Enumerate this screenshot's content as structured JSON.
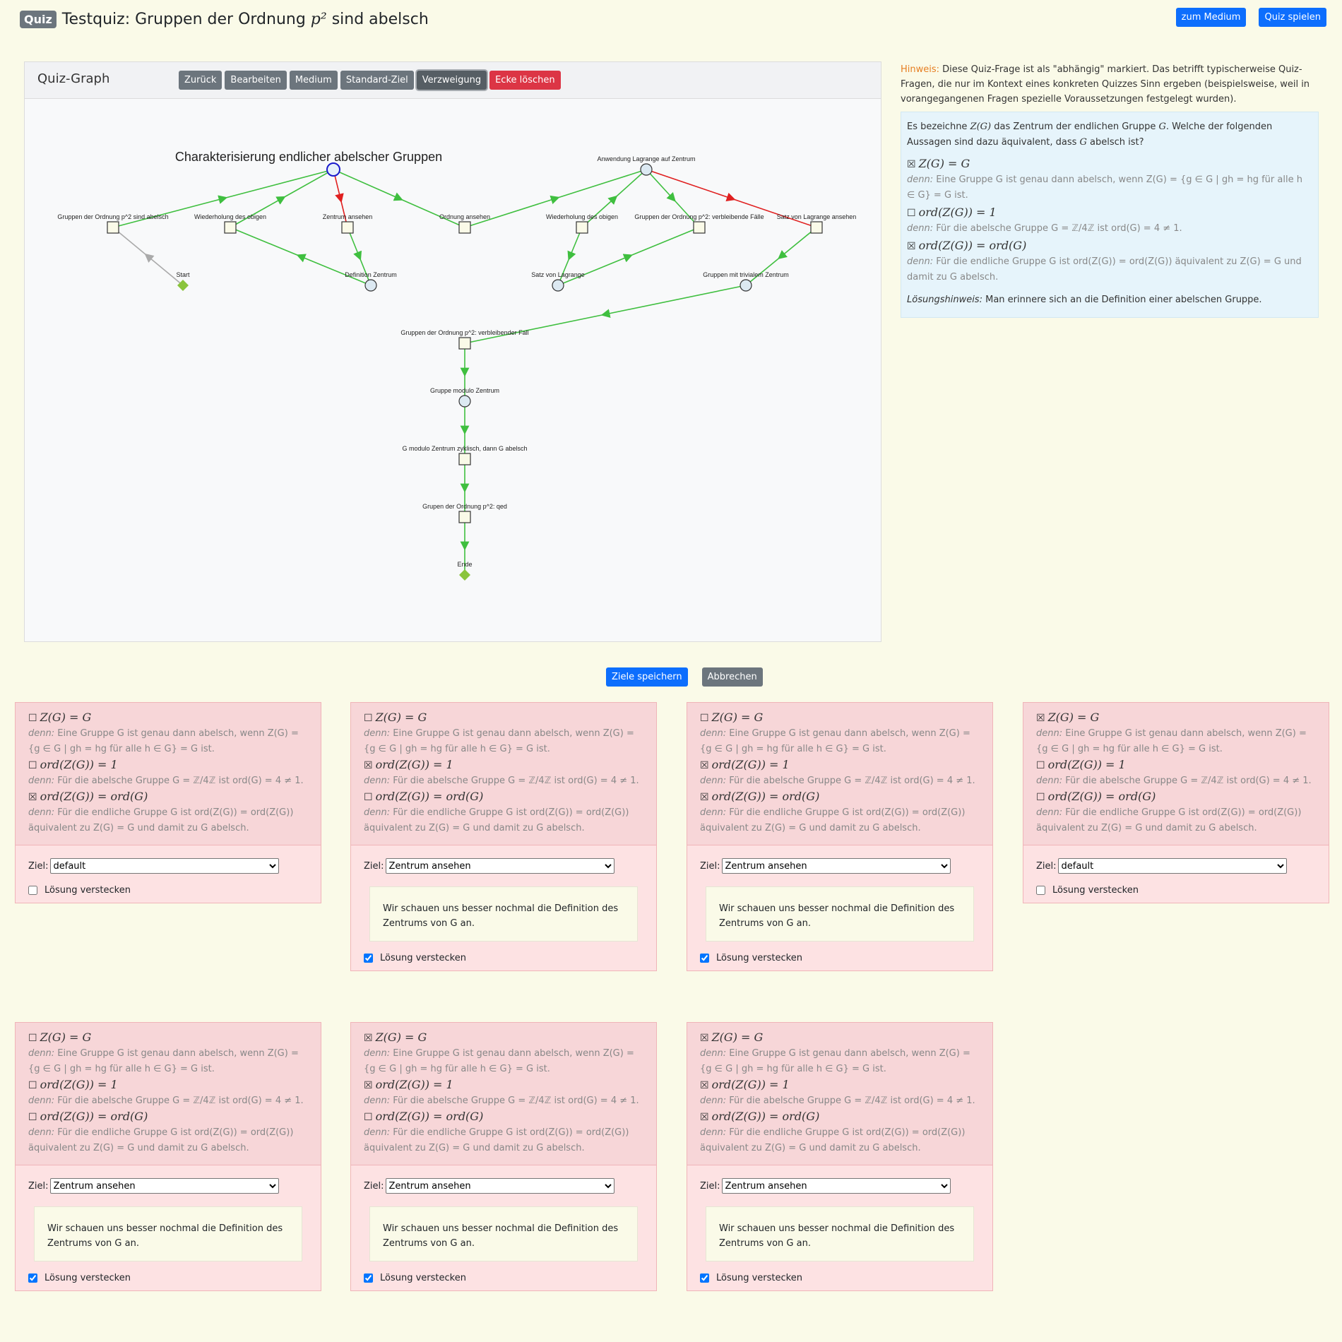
{
  "header": {
    "badge": "Quiz",
    "title_prefix": "Testquiz: Gruppen der Ordnung ",
    "title_math": "p²",
    "title_suffix": " sind abelsch",
    "btn_medium": "zum Medium",
    "btn_play": "Quiz spielen"
  },
  "graph": {
    "title": "Quiz-Graph",
    "toolbar": [
      "Zurück",
      "Bearbeiten",
      "Medium",
      "Standard-Ziel",
      "Verzweigung",
      "Ecke löschen"
    ],
    "heading": "Charakterisierung endlicher abelscher Gruppen",
    "nodes": [
      {
        "id": "root",
        "label": "",
        "shape": "circle-blue"
      },
      {
        "id": "lag",
        "label": "Anwendung Lagrange auf Zentrum",
        "shape": "circle"
      },
      {
        "id": "g1",
        "label": "Gruppen der Ordnung p^2 sind abelsch",
        "shape": "square"
      },
      {
        "id": "wh1",
        "label": "Wiederholung des obigen",
        "shape": "square"
      },
      {
        "id": "za",
        "label": "Zentrum ansehen",
        "shape": "square"
      },
      {
        "id": "oa",
        "label": "Ordnung ansehen",
        "shape": "square"
      },
      {
        "id": "wh2",
        "label": "Wiederholung des obigen",
        "shape": "square"
      },
      {
        "id": "grf",
        "label": "Gruppen der Ordnung p^2: verbleibende Fälle",
        "shape": "square"
      },
      {
        "id": "sla",
        "label": "Satz von Lagrange ansehen",
        "shape": "square"
      },
      {
        "id": "start",
        "label": "Start",
        "shape": "diamond"
      },
      {
        "id": "dz",
        "label": "Definition Zentrum",
        "shape": "circle"
      },
      {
        "id": "sl",
        "label": "Satz von Lagrange",
        "shape": "circle"
      },
      {
        "id": "gmt",
        "label": "Gruppen mit trivialem Zentrum",
        "shape": "circle"
      },
      {
        "id": "gvf",
        "label": "Gruppen der Ordnung p^2: verbleibender Fall",
        "shape": "square"
      },
      {
        "id": "gmz",
        "label": "Gruppe modulo Zentrum",
        "shape": "circle"
      },
      {
        "id": "gmzz",
        "label": "G modulo Zentrum zyklisch, dann G abelsch",
        "shape": "square"
      },
      {
        "id": "qed",
        "label": "Grupen der Ordnung p^2: qed",
        "shape": "square"
      },
      {
        "id": "ende",
        "label": "Ende",
        "shape": "diamond"
      }
    ],
    "edges": [
      {
        "from": "start",
        "to": "g1",
        "color": "gray"
      },
      {
        "from": "g1",
        "to": "root",
        "color": "green"
      },
      {
        "from": "wh1",
        "to": "root",
        "color": "green"
      },
      {
        "from": "root",
        "to": "za",
        "color": "red"
      },
      {
        "from": "root",
        "to": "oa",
        "color": "green"
      },
      {
        "from": "za",
        "to": "dz",
        "color": "green"
      },
      {
        "from": "dz",
        "to": "wh1",
        "color": "green"
      },
      {
        "from": "oa",
        "to": "lag",
        "color": "green"
      },
      {
        "from": "wh2",
        "to": "lag",
        "color": "green"
      },
      {
        "from": "lag",
        "to": "grf",
        "color": "green"
      },
      {
        "from": "lag",
        "to": "sla",
        "color": "red"
      },
      {
        "from": "wh2",
        "to": "sl",
        "color": "green"
      },
      {
        "from": "sl",
        "to": "grf",
        "color": "green"
      },
      {
        "from": "sla",
        "to": "gmt",
        "color": "green"
      },
      {
        "from": "gmt",
        "to": "gvf",
        "color": "green"
      },
      {
        "from": "gvf",
        "to": "gmz",
        "color": "green"
      },
      {
        "from": "gmz",
        "to": "gmzz",
        "color": "green"
      },
      {
        "from": "gmzz",
        "to": "qed",
        "color": "green"
      },
      {
        "from": "qed",
        "to": "ende",
        "color": "green"
      }
    ]
  },
  "hint": {
    "label": "Hinweis:",
    "text": " Diese Quiz-Frage ist als \"abhängig\" markiert. Das betrifft typischerweise Quiz-Fragen, die nur im Kontext eines konkreten Quizzes Sinn ergeben (beispielsweise, weil in vorangegangenen Fragen spezielle Voraussetzungen festgelegt wurden)."
  },
  "question": {
    "p1": "Es bezeichne ",
    "m1": "Z(G)",
    "p2": " das Zentrum der endlichen Gruppe ",
    "m2": "G",
    "p3": ". Welche der folgenden Aussagen sind dazu äquivalent, dass ",
    "m3": "G",
    "p4": " abelsch ist?",
    "options": [
      {
        "box": "☒",
        "stmt": "Z(G) = G",
        "denn": "Eine Gruppe G ist genau dann abelsch, wenn Z(G) = {g ∈ G | gh = hg für alle h ∈ G} = G ist."
      },
      {
        "box": "☐",
        "stmt": "ord(Z(G)) = 1",
        "denn": "Für die abelsche Gruppe G = ℤ/4ℤ ist ord(G) = 4 ≠ 1."
      },
      {
        "box": "☒",
        "stmt": "ord(Z(G)) = ord(G)",
        "denn": "Für die endliche Gruppe G ist ord(Z(G)) = ord(Z(G)) äquivalent zu Z(G) = G und damit zu G abelsch."
      }
    ],
    "loesung_label": "Lösungshinweis:",
    "loesung_text": " Man erinnere sich an die Definition einer abelschen Gruppe."
  },
  "actions": {
    "save": "Ziele speichern",
    "cancel": "Abbrechen"
  },
  "card_text": {
    "s1": "Z(G) = G",
    "d1": "Eine Gruppe G ist genau dann abelsch, wenn Z(G) = {g ∈ G | gh = hg für alle h ∈ G} = G ist.",
    "s2": "ord(Z(G)) = 1",
    "d2": "Für die abelsche Gruppe G = ℤ/4ℤ ist ord(G) = 4 ≠ 1.",
    "s3": "ord(Z(G)) = ord(G)",
    "d3": "Für die endliche Gruppe G ist ord(Z(G)) = ord(Z(G)) äquivalent zu Z(G) = G und damit zu G abelsch.",
    "denn": "denn:",
    "ziel": "Ziel:",
    "hide": "Lösung verstecken",
    "note": "Wir schauen uns besser nochmal die Definition des Zentrums von G an."
  },
  "cards": [
    {
      "b1": "☐",
      "b2": "☐",
      "b3": "☒",
      "ziel": "default",
      "hide": false
    },
    {
      "b1": "☐",
      "b2": "☒",
      "b3": "☐",
      "ziel": "Zentrum ansehen",
      "hide": true
    },
    {
      "b1": "☐",
      "b2": "☒",
      "b3": "☒",
      "ziel": "Zentrum ansehen",
      "hide": true
    },
    {
      "b1": "☒",
      "b2": "☐",
      "b3": "☐",
      "ziel": "default",
      "hide": false
    },
    {
      "b1": "☐",
      "b2": "☐",
      "b3": "☐",
      "ziel": "Zentrum ansehen",
      "hide": true
    },
    {
      "b1": "☒",
      "b2": "☒",
      "b3": "☐",
      "ziel": "Zentrum ansehen",
      "hide": true
    },
    {
      "b1": "☒",
      "b2": "☒",
      "b3": "☒",
      "ziel": "Zentrum ansehen",
      "hide": true
    }
  ]
}
